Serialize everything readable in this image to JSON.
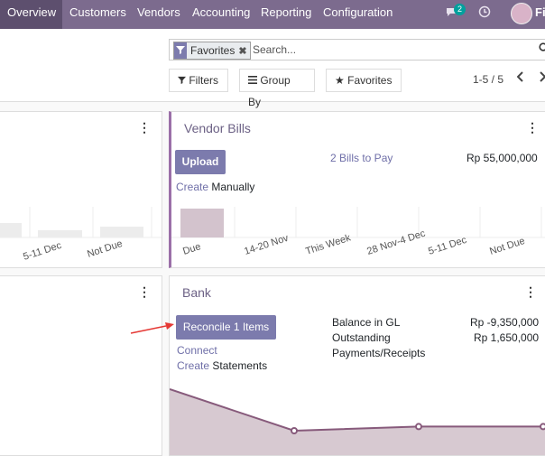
{
  "nav": {
    "items": [
      "Overview",
      "Customers",
      "Vendors",
      "Accounting",
      "Reporting",
      "Configuration"
    ],
    "active": "Overview",
    "messages_badge": "2",
    "user_initial": "Fi"
  },
  "search": {
    "facet_label": "Favorites",
    "placeholder": "Search..."
  },
  "options": {
    "filters": "Filters",
    "group_by": "Group By",
    "favorites": "Favorites"
  },
  "pager": {
    "value": "1-5 / 5"
  },
  "left_card_top": {
    "ticks": [
      "5-11 Dec",
      "Not Due"
    ]
  },
  "vendor_bills": {
    "title": "Vendor Bills",
    "upload_label": "Upload",
    "bills_link": "2 Bills to Pay",
    "amount": "Rp 55,000,000",
    "create_link": "Create",
    "create_rest": "Manually",
    "chart_data": {
      "type": "bar",
      "categories": [
        "Due",
        "14-20 Nov",
        "This Week",
        "28 Nov-4 Dec",
        "5-11 Dec",
        "Not Due"
      ],
      "values": [
        55000000,
        0,
        0,
        0,
        0,
        0
      ],
      "bar_color": "#d3c3cd"
    }
  },
  "bank": {
    "title": "Bank",
    "reconcile_label": "Reconcile 1 Items",
    "balance_label": "Balance in GL",
    "balance_value": "Rp -9,350,000",
    "outstanding_label": "Outstanding",
    "outstanding_sub": "Payments/Receipts",
    "outstanding_value": "Rp 1,650,000",
    "connect_link": "Connect",
    "create_link": "Create",
    "create_rest": "Statements",
    "chart_data": {
      "type": "area",
      "values": [
        1.0,
        0.0,
        0.1,
        0.1
      ],
      "line_color": "#875a7b",
      "fill_color": "#d7c9d1"
    }
  },
  "colors": {
    "navbar": "#7c6b8e",
    "primary": "#7c7bad",
    "accent_border": "#9b6fa8"
  }
}
